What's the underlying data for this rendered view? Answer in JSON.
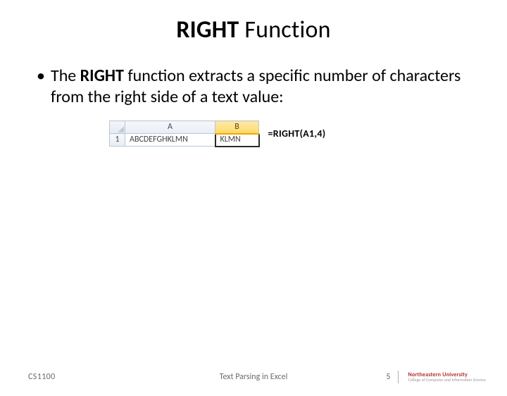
{
  "title": {
    "bold": "RIGHT",
    "rest": " Function"
  },
  "bullet": {
    "pre": "The ",
    "strong": "RIGHT",
    "post": " function extracts a specific number of characters from the right side of a text value:"
  },
  "excel": {
    "columns": [
      "A",
      "B"
    ],
    "rows": [
      "1"
    ],
    "cells": {
      "A1": "ABCDEFGHKLMN",
      "B1": "KLMN"
    },
    "active_cell": "B1"
  },
  "formula_label": "=RIGHT(A1,4)",
  "footer": {
    "course": "CS1100",
    "center": "Text Parsing in Excel",
    "page_number": "5",
    "university_top": "Northeastern University",
    "university_bot": "College of Computer and Information Science"
  },
  "chart_data": {
    "type": "table",
    "title": "Excel RIGHT example",
    "columns": [
      "",
      "A",
      "B"
    ],
    "rows": [
      [
        "1",
        "ABCDEFGHKLMN",
        "KLMN"
      ]
    ],
    "formula": {
      "cell": "B1",
      "text": "=RIGHT(A1,4)"
    }
  }
}
